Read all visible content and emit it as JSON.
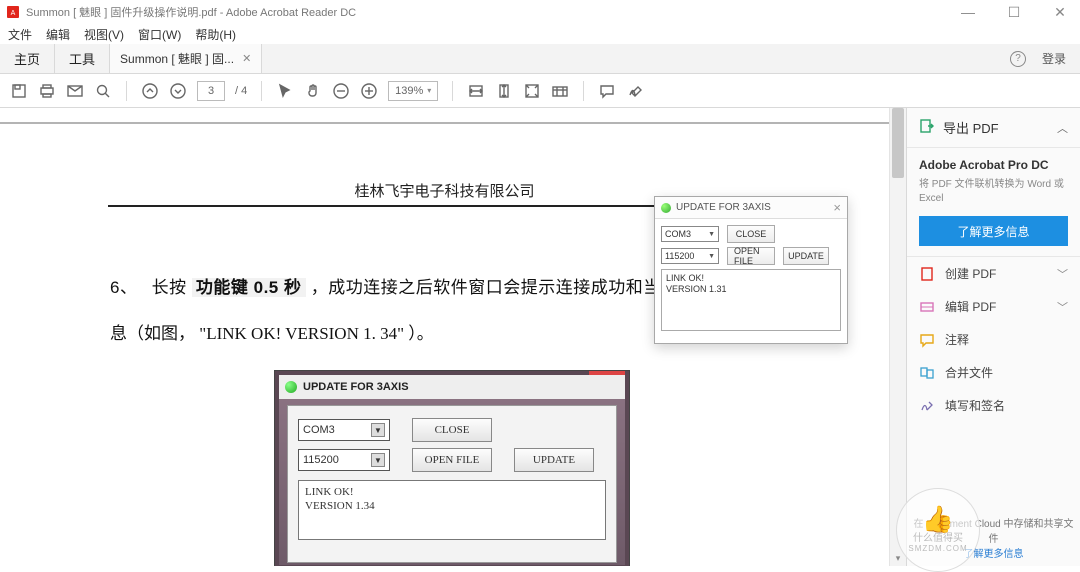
{
  "titlebar": {
    "title": "Summon [ 魅眼 ] 固件升级操作说明.pdf - Adobe Acrobat Reader DC"
  },
  "menubar": [
    "文件",
    "编辑",
    "视图(V)",
    "窗口(W)",
    "帮助(H)"
  ],
  "tabs": {
    "home": "主页",
    "tools": "工具",
    "doc": "Summon [ 魅眼 ] 固...",
    "login": "登录"
  },
  "toolbar": {
    "page_current": "3",
    "page_total": "/ 4",
    "zoom": "139%"
  },
  "document": {
    "company": "桂林飞宇电子科技有限公司",
    "line_prefix": "6、　 长按 ",
    "line_hl": "功能键 0.5 秒",
    "line_suffix": " ，成功连接之后软件窗口会提示连接成功和当前固件版本信",
    "line2": "息（如图， \"LINK OK! VERSION 1. 34\" ）。"
  },
  "embed": {
    "title": "UPDATE FOR 3AXIS",
    "com": "COM3",
    "baud": "115200",
    "close": "CLOSE",
    "open": "OPEN FILE",
    "update": "UPDATE",
    "log": "LINK OK!\nVERSION 1.34"
  },
  "float": {
    "title": "UPDATE FOR 3AXIS",
    "com": "COM3",
    "baud": "115200",
    "close": "CLOSE",
    "open": "OPEN FILE",
    "update": "UPDATE",
    "log": "LINK OK!\nVERSION 1.31"
  },
  "rpanel": {
    "export": "导出 PDF",
    "pro_title": "Adobe Acrobat Pro DC",
    "pro_sub": "将 PDF 文件联机转换为 Word 或 Excel",
    "learn": "了解更多信息",
    "create": "创建 PDF",
    "edit": "编辑 PDF",
    "comment": "注释",
    "merge": "合并文件",
    "fill": "填写和签名",
    "cloud": "在 Document Cloud 中存储和共享文件",
    "cloud_link": "了解更多信息"
  },
  "watermark": {
    "line1": "什么值得买",
    "line2": "SMZDM.COM"
  },
  "colors": {
    "accent": "#1d8fe1",
    "pdf_red": "#e1261c"
  }
}
